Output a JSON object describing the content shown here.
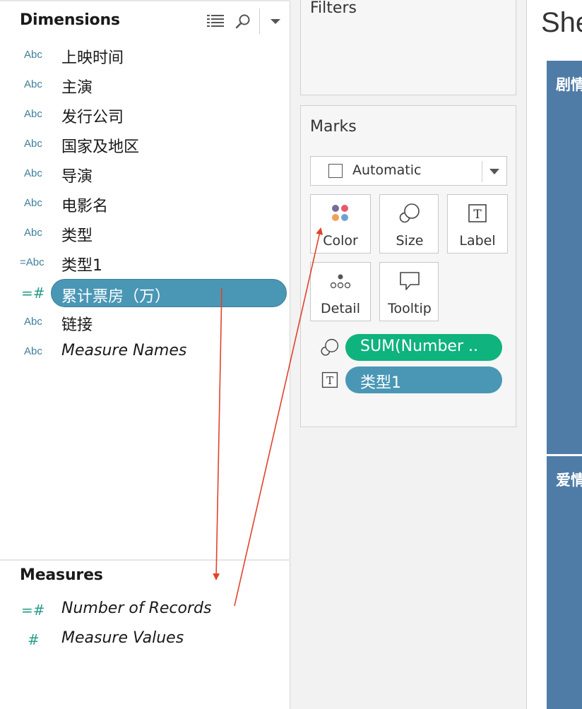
{
  "data_pane": {
    "dimensions_title": "Dimensions",
    "dimensions": [
      {
        "type": "Abc",
        "name": "上映时间"
      },
      {
        "type": "Abc",
        "name": "主演"
      },
      {
        "type": "Abc",
        "name": "发行公司"
      },
      {
        "type": "Abc",
        "name": "国家及地区"
      },
      {
        "type": "Abc",
        "name": "导演"
      },
      {
        "type": "Abc",
        "name": "电影名"
      },
      {
        "type": "Abc",
        "name": "类型"
      },
      {
        "type": "=Abc",
        "name": "类型1"
      },
      {
        "type": "=#",
        "name": "累计票房（万）"
      },
      {
        "type": "Abc",
        "name": "链接"
      },
      {
        "type": "Abc",
        "name": "Measure Names"
      }
    ],
    "measures_title": "Measures",
    "measures": [
      {
        "type": "=#",
        "name": "Number of Records"
      },
      {
        "type": "#",
        "name": "Measure Values"
      }
    ]
  },
  "shelves": {
    "filters_title": "Filters",
    "marks_title": "Marks",
    "mark_type": "Automatic",
    "mark_buttons": {
      "color": "Color",
      "size": "Size",
      "label": "Label",
      "detail": "Detail",
      "tooltip": "Tooltip"
    },
    "size_pill": "SUM(Number ..",
    "label_pill": "类型1"
  },
  "sheet": {
    "title": "She",
    "cells": [
      "剧情",
      "爱情"
    ]
  },
  "colors": {
    "dimension_pill": "#4a97b5",
    "measure_pill": "#0fb37d",
    "treemap_cell": "#4f7ba7",
    "arrow": "#e0432c"
  }
}
